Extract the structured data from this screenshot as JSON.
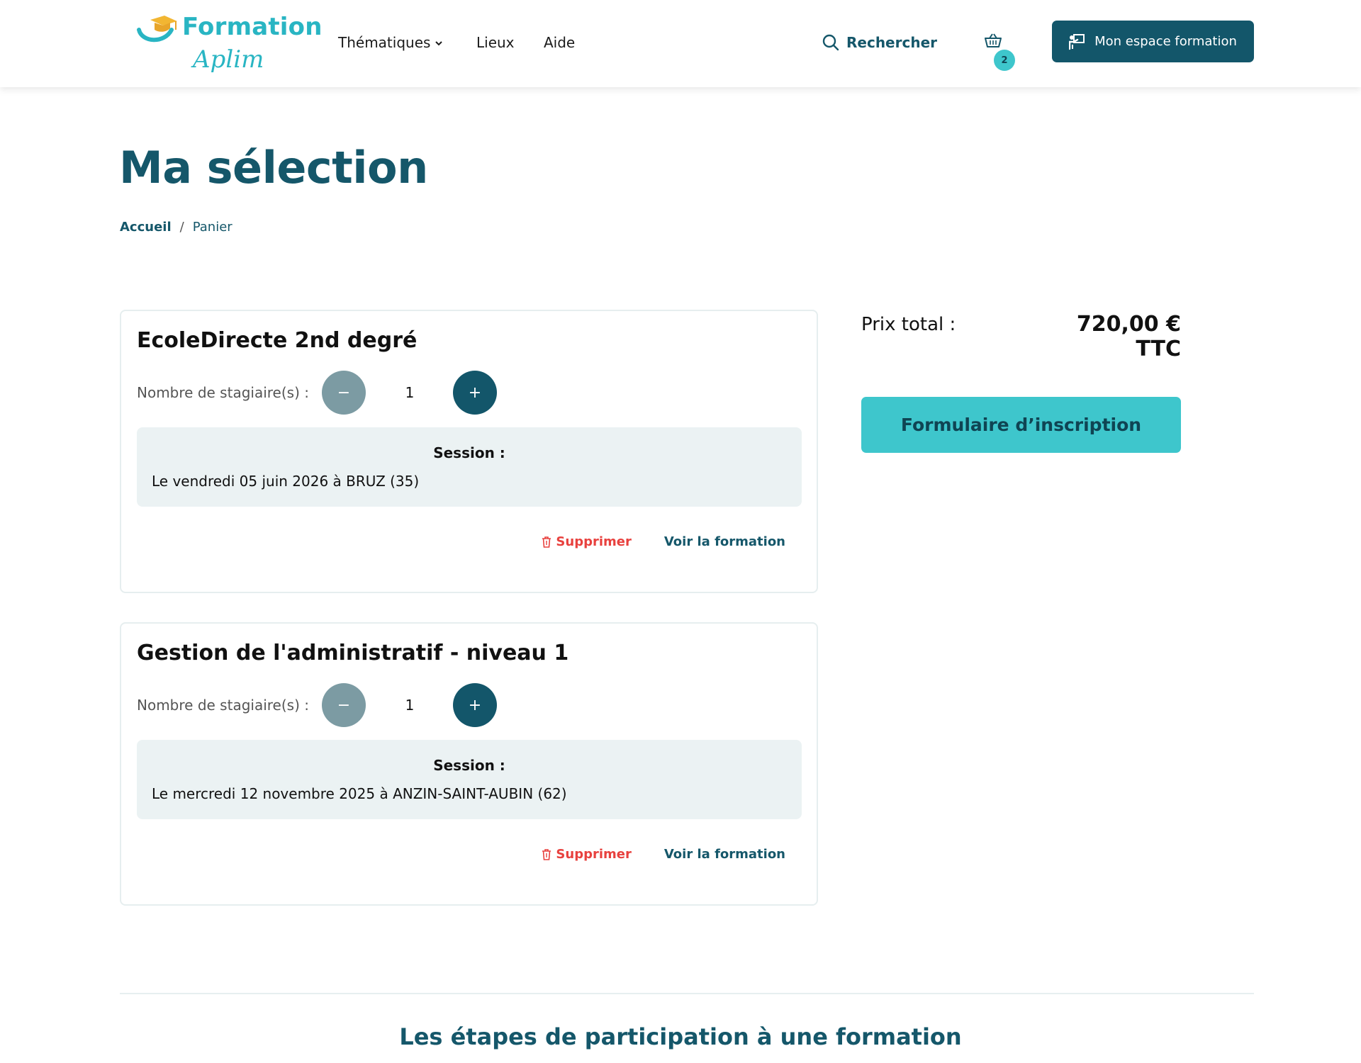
{
  "header": {
    "logo_word": "Formation",
    "logo_sub": "Aplim",
    "nav": [
      {
        "label": "Thématiques"
      },
      {
        "label": "Lieux"
      },
      {
        "label": "Aide"
      }
    ],
    "search_label": "Rechercher",
    "cart_count": "2",
    "account_button": "Mon espace formation"
  },
  "page": {
    "title": "Ma sélection",
    "breadcrumb": {
      "home": "Accueil",
      "separator": "/",
      "current": "Panier"
    }
  },
  "cart_items": [
    {
      "title": "EcoleDirecte 2nd degré",
      "qty_label": "Nombre de stagiaire(s) :",
      "qty_value": "1",
      "minus": "−",
      "plus": "+",
      "session_label": "Session :",
      "session_value": "Le vendredi 05 juin 2026 à BRUZ (35)",
      "delete_label": "Supprimer",
      "view_label": "Voir la formation"
    },
    {
      "title": "Gestion de l'administratif - niveau 1",
      "qty_label": "Nombre de stagiaire(s) :",
      "qty_value": "1",
      "minus": "−",
      "plus": "+",
      "session_label": "Session :",
      "session_value": "Le mercredi 12 novembre 2025 à ANZIN-SAINT-AUBIN (62)",
      "delete_label": "Supprimer",
      "view_label": "Voir la formation"
    }
  ],
  "summary": {
    "total_label": "Prix total :",
    "total_value": "720,00 € TTC",
    "signup_button": "Formulaire d’inscription"
  },
  "steps": {
    "title": "Les étapes de participation à une formation"
  },
  "colors": {
    "primary": "#13566a",
    "accent": "#3ec6cc",
    "danger": "#e8413e",
    "session_bg": "#ebf2f3"
  },
  "icons": [
    "graduation-cap-icon",
    "chevron-down-icon",
    "search-icon",
    "basket-icon",
    "teacher-icon",
    "trash-icon"
  ]
}
